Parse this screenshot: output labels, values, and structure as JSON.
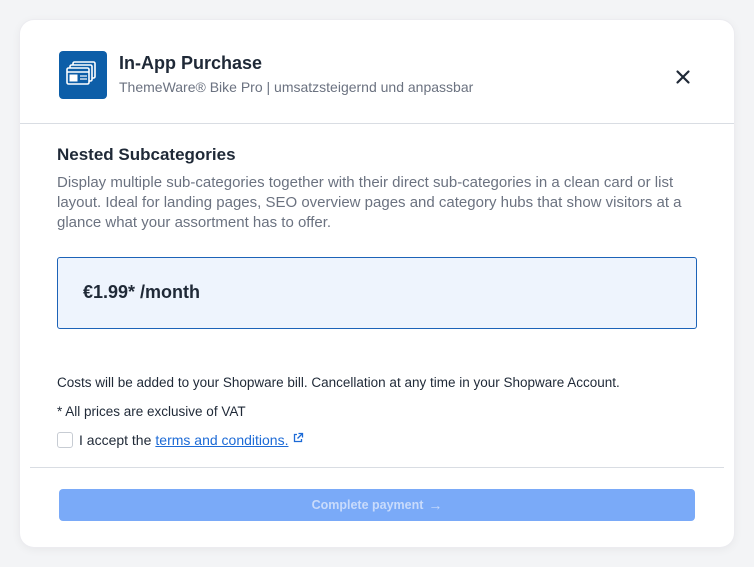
{
  "modal": {
    "title": "In-App Purchase",
    "subtitle": "ThemeWare® Bike Pro | umsatzsteigernd und anpassbar",
    "close_icon": "close-icon"
  },
  "feature": {
    "title": "Nested Subcategories",
    "description": "Display multiple sub-categories together with their direct sub-categories in a clean card or list layout. Ideal for landing pages, SEO overview pages and category hubs that show visitors at a glance what your assortment has to offer."
  },
  "price": {
    "label": "€1.99* /month"
  },
  "notes": {
    "costs": "Costs will be added to your Shopware bill. Cancellation at any time in your Shopware Account.",
    "vat": "* All prices are exclusive of VAT"
  },
  "terms": {
    "prefix": "I accept the",
    "link_text": "terms and conditions.",
    "checked": false,
    "link_icon": "external-link-icon"
  },
  "footer": {
    "pay_label": "Complete payment",
    "pay_arrow": "→",
    "pay_disabled": true
  },
  "colors": {
    "accent": "#1c63b8",
    "app_icon_bg": "#0d5ea8",
    "price_bg": "#eef4fd",
    "pay_button_disabled": "#7aaaf8",
    "link": "#1c6ad6"
  }
}
